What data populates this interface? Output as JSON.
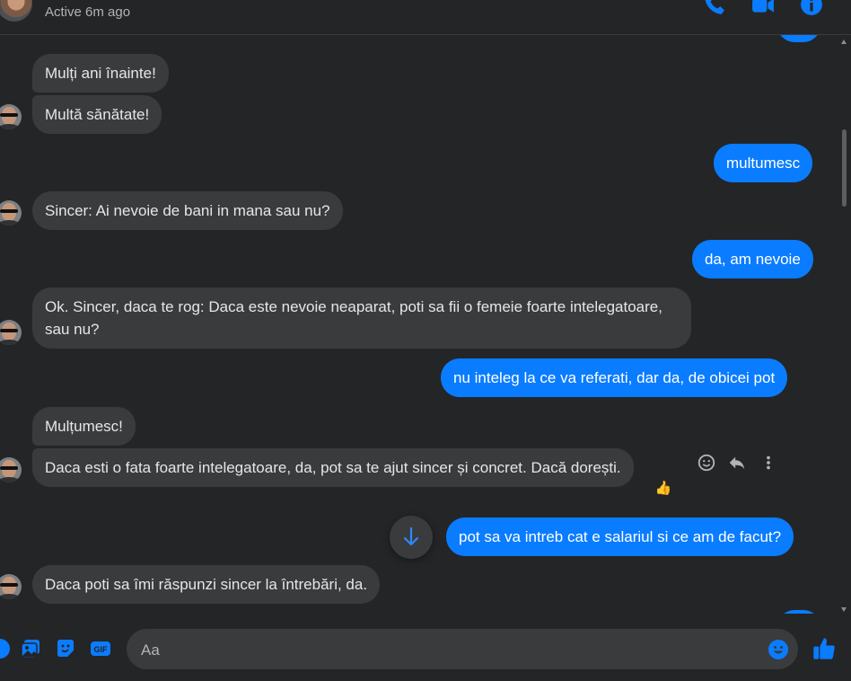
{
  "header": {
    "status": "Active 6m ago",
    "icons": [
      "phone-icon",
      "video-call-icon",
      "info-icon"
    ]
  },
  "messages": [
    {
      "side": "in",
      "text": "Mulți ani înainte!"
    },
    {
      "side": "in",
      "text": "Multă sănătate!"
    },
    {
      "side": "out",
      "text": "multumesc"
    },
    {
      "side": "in",
      "text": "Sincer: Ai nevoie de bani in mana sau nu?"
    },
    {
      "side": "out",
      "text": "da, am nevoie"
    },
    {
      "side": "in",
      "text": "Ok. Sincer, daca te rog: Daca este nevoie neaparat, poti sa fii o femeie foarte intelegatoare, sau nu?"
    },
    {
      "side": "out",
      "text": "nu inteleg la ce va referati, dar da, de obicei pot"
    },
    {
      "side": "in",
      "text": "Mulțumesc!"
    },
    {
      "side": "in",
      "text": "Daca esti o fata foarte intelegatoare, da, pot sa te ajut sincer și concret. Dacă dorești."
    },
    {
      "side": "out",
      "text": "pot sa va intreb cat e salariul si ce am de facut?"
    },
    {
      "side": "in",
      "text": "Daca poti sa îmi răspunzi sincer la întrebări, da."
    }
  ],
  "reaction": "👍",
  "message_actions": [
    "react-icon",
    "reply-icon",
    "more-icon"
  ],
  "composer": {
    "placeholder": "Aa",
    "icons": [
      "plus-icon",
      "photo-icon",
      "sticker-icon",
      "gif-icon",
      "emoji-icon",
      "like-icon"
    ]
  },
  "colors": {
    "background": "#242526",
    "incoming_bubble": "#3a3b3c",
    "outgoing_bubble": "#0a7cff",
    "accent": "#0a7cff"
  }
}
